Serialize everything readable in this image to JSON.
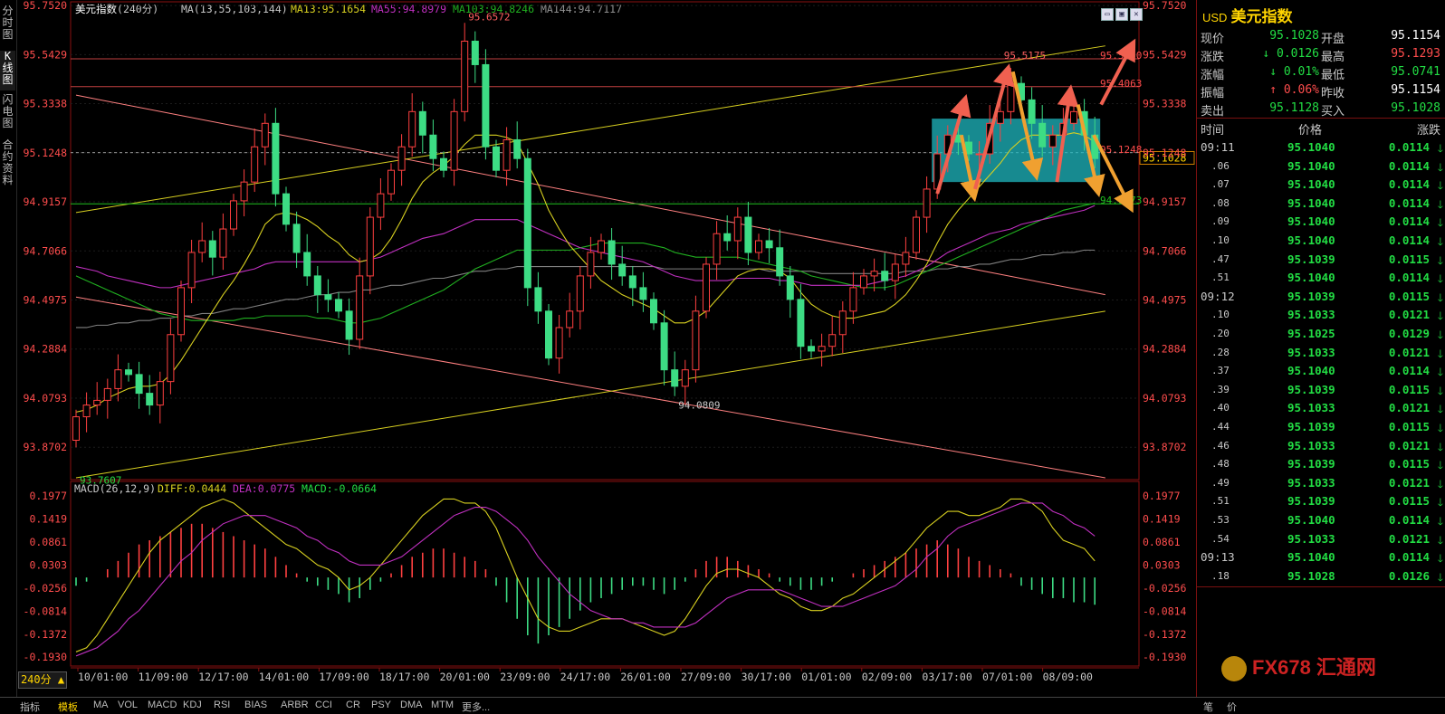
{
  "left_tabs": [
    "分时图",
    "K线图",
    "闪电图",
    "合约资料"
  ],
  "main_header": {
    "title": "美元指数",
    "period": "240分",
    "ma_label": "MA(13,55,103,144)",
    "ma13": "MA13:95.1654",
    "ma55": "MA55:94.8979",
    "ma103": "MA103:94.8246",
    "ma144": "MA144:94.7117"
  },
  "macd_header": {
    "label": "MACD(26,12,9)",
    "diff": "DIFF:0.0444",
    "dea": "DEA:0.0775",
    "macd": "MACD:-0.0664"
  },
  "period_selector": "240分 ▲",
  "bottom_tabs": [
    "指标",
    "模板",
    "MA",
    "VOL",
    "MACD",
    "KDJ",
    "RSI",
    "BIAS",
    "ARBR",
    "CCI",
    "CR",
    "PSY",
    "DMA",
    "MTM",
    "更多..."
  ],
  "bottom_right_tabs": [
    "笔",
    "价"
  ],
  "watermark": "FX678 汇通网",
  "colors": {
    "up": "#ff4040",
    "down": "#3ddc84",
    "ma13": "#d8d020",
    "ma55": "#20b020",
    "ma103": "#c030c0",
    "ma144": "#808080",
    "frame": "#8a1010"
  },
  "chart_data": {
    "type": "candlestick",
    "title": "美元指数",
    "price_axis": {
      "ticks": [
        95.752,
        95.5429,
        95.3338,
        95.1248,
        94.9157,
        94.7066,
        94.4975,
        94.2884,
        94.0793,
        93.8702
      ],
      "tick_labels": [
        "95.7520",
        "95.5429",
        "95.3338",
        "95.1248",
        "94.9157",
        "94.7066",
        "94.4975",
        "94.2884",
        "94.0793",
        "93.8702"
      ],
      "range": [
        93.74,
        95.76
      ]
    },
    "x_axis_labels": [
      "10/01:00",
      "11/09:00",
      "12/17:00",
      "14/01:00",
      "17/09:00",
      "18/17:00",
      "20/01:00",
      "23/09:00",
      "24/17:00",
      "26/01:00",
      "27/09:00",
      "30/17:00",
      "01/01:00",
      "02/09:00",
      "03/17:00",
      "07/01:00",
      "08/09:00"
    ],
    "price_annotations": [
      {
        "label": "95.6572",
        "value": 95.6572
      },
      {
        "label": "93.7607",
        "value": 93.7607
      },
      {
        "label": "94.0809",
        "value": 94.0809
      },
      {
        "label": "95.5175",
        "value": 95.5175
      },
      {
        "label": "95.5250",
        "value": 95.525
      },
      {
        "label": "95.4063",
        "value": 95.4063
      },
      {
        "label": "95.1248",
        "value": 95.1248
      },
      {
        "label": "94.9073",
        "value": 94.9073
      }
    ],
    "current_price_tag": "95.1028",
    "closes": [
      94.0,
      94.05,
      94.07,
      94.12,
      94.2,
      94.18,
      94.1,
      94.05,
      94.15,
      94.35,
      94.55,
      94.7,
      94.75,
      94.68,
      94.8,
      94.92,
      95.0,
      95.15,
      95.25,
      94.95,
      94.82,
      94.7,
      94.6,
      94.52,
      94.5,
      94.45,
      94.33,
      94.6,
      94.85,
      94.95,
      95.05,
      95.15,
      95.3,
      95.2,
      95.1,
      95.05,
      95.3,
      95.6,
      95.5,
      95.15,
      95.05,
      95.18,
      95.1,
      94.55,
      94.45,
      94.25,
      94.38,
      94.45,
      94.6,
      94.7,
      94.75,
      94.65,
      94.6,
      94.55,
      94.5,
      94.4,
      94.2,
      94.13,
      94.2,
      94.45,
      94.65,
      94.78,
      94.75,
      94.85,
      94.7,
      94.75,
      94.72,
      94.6,
      94.5,
      94.3,
      94.28,
      94.3,
      94.35,
      94.45,
      94.55,
      94.6,
      94.62,
      94.58,
      94.65,
      94.7,
      94.85,
      94.97,
      95.12,
      95.2,
      95.17,
      95.12,
      95.12,
      95.25,
      95.3,
      95.42,
      95.35,
      95.25,
      95.15,
      95.2,
      95.25,
      95.3,
      95.2,
      95.1
    ],
    "ma13": [
      94.02,
      94.03,
      94.05,
      94.08,
      94.1,
      94.12,
      94.13,
      94.13,
      94.14,
      94.18,
      94.24,
      94.31,
      94.38,
      94.45,
      94.52,
      94.58,
      94.65,
      94.73,
      94.82,
      94.86,
      94.87,
      94.86,
      94.84,
      94.81,
      94.77,
      94.74,
      94.69,
      94.66,
      94.67,
      94.7,
      94.76,
      94.84,
      94.93,
      95.0,
      95.04,
      95.07,
      95.11,
      95.16,
      95.2,
      95.2,
      95.2,
      95.19,
      95.17,
      95.08,
      94.99,
      94.88,
      94.8,
      94.73,
      94.68,
      94.63,
      94.58,
      94.55,
      94.52,
      94.5,
      94.48,
      94.46,
      94.43,
      94.4,
      94.4,
      94.42,
      94.45,
      94.5,
      94.55,
      94.6,
      94.62,
      94.63,
      94.63,
      94.62,
      94.59,
      94.53,
      94.48,
      94.45,
      94.43,
      94.42,
      94.42,
      94.43,
      94.44,
      94.45,
      94.48,
      94.52,
      94.58,
      94.65,
      94.74,
      94.82,
      94.88,
      94.93,
      94.98,
      95.03,
      95.08,
      95.14,
      95.18,
      95.2,
      95.2,
      95.2,
      95.2,
      95.21,
      95.2,
      95.17
    ],
    "ma55": [
      94.64,
      94.63,
      94.62,
      94.6,
      94.59,
      94.58,
      94.57,
      94.56,
      94.55,
      94.55,
      94.56,
      94.57,
      94.58,
      94.59,
      94.6,
      94.61,
      94.62,
      94.63,
      94.65,
      94.66,
      94.66,
      94.66,
      94.66,
      94.66,
      94.66,
      94.66,
      94.66,
      94.66,
      94.67,
      94.68,
      94.7,
      94.72,
      94.74,
      94.76,
      94.77,
      94.78,
      94.8,
      94.82,
      94.84,
      94.84,
      94.84,
      94.84,
      94.84,
      94.82,
      94.8,
      94.78,
      94.76,
      94.74,
      94.72,
      94.71,
      94.7,
      94.69,
      94.68,
      94.67,
      94.66,
      94.64,
      94.62,
      94.6,
      94.59,
      94.58,
      94.58,
      94.58,
      94.58,
      94.59,
      94.59,
      94.59,
      94.59,
      94.58,
      94.58,
      94.57,
      94.56,
      94.56,
      94.56,
      94.56,
      94.56,
      94.56,
      94.57,
      94.58,
      94.59,
      94.6,
      94.62,
      94.64,
      94.67,
      94.7,
      94.72,
      94.74,
      94.76,
      94.78,
      94.79,
      94.8,
      94.82,
      94.83,
      94.84,
      94.85,
      94.86,
      94.87,
      94.88,
      94.9
    ],
    "ma103": [
      94.6,
      94.58,
      94.56,
      94.54,
      94.52,
      94.5,
      94.48,
      94.46,
      94.44,
      94.43,
      94.42,
      94.41,
      94.41,
      94.41,
      94.41,
      94.41,
      94.42,
      94.42,
      94.43,
      94.43,
      94.43,
      94.43,
      94.43,
      94.42,
      94.42,
      94.41,
      94.4,
      94.4,
      94.41,
      94.42,
      94.44,
      94.46,
      94.48,
      94.5,
      94.52,
      94.54,
      94.57,
      94.6,
      94.63,
      94.65,
      94.67,
      94.69,
      94.71,
      94.71,
      94.71,
      94.71,
      94.71,
      94.71,
      94.72,
      94.73,
      94.74,
      94.74,
      94.74,
      94.74,
      94.74,
      94.73,
      94.72,
      94.7,
      94.69,
      94.68,
      94.68,
      94.68,
      94.68,
      94.68,
      94.67,
      94.66,
      94.65,
      94.64,
      94.63,
      94.62,
      94.6,
      94.59,
      94.58,
      94.57,
      94.56,
      94.55,
      94.55,
      94.55,
      94.56,
      94.58,
      94.6,
      94.62,
      94.64,
      94.66,
      94.68,
      94.7,
      94.72,
      94.74,
      94.76,
      94.78,
      94.8,
      94.82,
      94.84,
      94.86,
      94.88,
      94.89,
      94.9,
      94.91
    ],
    "ma144": [
      94.38,
      94.38,
      94.39,
      94.39,
      94.4,
      94.4,
      94.41,
      94.41,
      94.42,
      94.42,
      94.43,
      94.43,
      94.44,
      94.44,
      94.45,
      94.46,
      94.46,
      94.47,
      94.48,
      94.49,
      94.5,
      94.5,
      94.51,
      94.52,
      94.52,
      94.53,
      94.53,
      94.54,
      94.54,
      94.55,
      94.56,
      94.56,
      94.57,
      94.58,
      94.59,
      94.59,
      94.6,
      94.61,
      94.62,
      94.62,
      94.63,
      94.63,
      94.64,
      94.64,
      94.64,
      94.64,
      94.64,
      94.64,
      94.64,
      94.64,
      94.64,
      94.64,
      94.64,
      94.64,
      94.64,
      94.64,
      94.63,
      94.63,
      94.63,
      94.63,
      94.63,
      94.63,
      94.63,
      94.63,
      94.63,
      94.63,
      94.62,
      94.62,
      94.62,
      94.62,
      94.62,
      94.61,
      94.61,
      94.61,
      94.61,
      94.61,
      94.61,
      94.61,
      94.61,
      94.62,
      94.62,
      94.62,
      94.63,
      94.63,
      94.64,
      94.64,
      94.65,
      94.65,
      94.66,
      94.67,
      94.67,
      94.68,
      94.69,
      94.69,
      94.7,
      94.7,
      94.71,
      94.71
    ],
    "trendlines": [
      {
        "color": "#ff8080",
        "from": [
          0,
          95.37
        ],
        "to": [
          98,
          94.52
        ]
      },
      {
        "color": "#ff8080",
        "from": [
          0,
          94.51
        ],
        "to": [
          98,
          93.74
        ]
      },
      {
        "color": "#d8d020",
        "from": [
          0,
          94.87
        ],
        "to": [
          98,
          95.58
        ]
      },
      {
        "color": "#d8d020",
        "from": [
          0,
          93.74
        ],
        "to": [
          98,
          94.45
        ]
      }
    ],
    "horizontal_lines": [
      {
        "value": 95.525,
        "color": "#c04040"
      },
      {
        "value": 95.4063,
        "color": "#c04040"
      },
      {
        "value": 94.9073,
        "color": "#20c020"
      }
    ],
    "macd": {
      "axis_ticks": [
        0.1977,
        0.1419,
        0.0861,
        0.0303,
        -0.0256,
        -0.0814,
        -0.1372,
        -0.193
      ],
      "axis_labels": [
        "0.1977",
        "0.1419",
        "0.0861",
        "0.0303",
        "-0.0256",
        "-0.0814",
        "-0.1372",
        "-0.1930"
      ],
      "range": [
        -0.21,
        0.215
      ],
      "hist": [
        -0.02,
        -0.01,
        0.0,
        0.02,
        0.04,
        0.06,
        0.08,
        0.09,
        0.1,
        0.11,
        0.12,
        0.13,
        0.13,
        0.12,
        0.11,
        0.1,
        0.09,
        0.08,
        0.07,
        0.05,
        0.03,
        0.01,
        -0.01,
        -0.02,
        -0.03,
        -0.04,
        -0.06,
        -0.05,
        -0.03,
        -0.01,
        0.01,
        0.03,
        0.05,
        0.06,
        0.07,
        0.07,
        0.06,
        0.05,
        0.04,
        0.02,
        -0.02,
        -0.06,
        -0.1,
        -0.14,
        -0.16,
        -0.14,
        -0.12,
        -0.1,
        -0.08,
        -0.06,
        -0.05,
        -0.04,
        -0.03,
        -0.02,
        -0.02,
        -0.03,
        -0.04,
        -0.03,
        -0.01,
        0.02,
        0.04,
        0.05,
        0.05,
        0.04,
        0.03,
        0.02,
        0.01,
        -0.01,
        -0.02,
        -0.03,
        -0.03,
        -0.02,
        -0.01,
        0.0,
        0.01,
        0.02,
        0.03,
        0.04,
        0.05,
        0.06,
        0.07,
        0.08,
        0.09,
        0.08,
        0.07,
        0.05,
        0.04,
        0.03,
        0.02,
        0.01,
        -0.02,
        -0.03,
        -0.04,
        -0.05,
        -0.05,
        -0.06,
        -0.06,
        -0.066
      ],
      "diff": [
        -0.18,
        -0.17,
        -0.14,
        -0.1,
        -0.06,
        -0.02,
        0.02,
        0.06,
        0.09,
        0.11,
        0.13,
        0.15,
        0.17,
        0.18,
        0.19,
        0.18,
        0.16,
        0.14,
        0.12,
        0.1,
        0.08,
        0.07,
        0.05,
        0.03,
        0.02,
        0.0,
        -0.03,
        -0.02,
        0.0,
        0.03,
        0.06,
        0.09,
        0.12,
        0.15,
        0.17,
        0.19,
        0.19,
        0.18,
        0.18,
        0.16,
        0.12,
        0.06,
        0.0,
        -0.05,
        -0.1,
        -0.12,
        -0.13,
        -0.13,
        -0.12,
        -0.11,
        -0.1,
        -0.1,
        -0.1,
        -0.11,
        -0.12,
        -0.13,
        -0.14,
        -0.13,
        -0.1,
        -0.06,
        -0.02,
        0.01,
        0.02,
        0.02,
        0.01,
        0.0,
        -0.02,
        -0.04,
        -0.05,
        -0.07,
        -0.08,
        -0.08,
        -0.07,
        -0.05,
        -0.04,
        -0.02,
        0.0,
        0.02,
        0.04,
        0.06,
        0.09,
        0.12,
        0.14,
        0.16,
        0.16,
        0.15,
        0.15,
        0.16,
        0.17,
        0.19,
        0.19,
        0.18,
        0.16,
        0.12,
        0.09,
        0.08,
        0.07,
        0.04
      ],
      "dea": [
        -0.19,
        -0.18,
        -0.17,
        -0.15,
        -0.13,
        -0.1,
        -0.08,
        -0.05,
        -0.02,
        0.01,
        0.04,
        0.06,
        0.09,
        0.11,
        0.13,
        0.14,
        0.15,
        0.15,
        0.15,
        0.14,
        0.13,
        0.12,
        0.1,
        0.09,
        0.07,
        0.06,
        0.04,
        0.03,
        0.03,
        0.03,
        0.04,
        0.05,
        0.07,
        0.09,
        0.11,
        0.13,
        0.15,
        0.16,
        0.17,
        0.17,
        0.16,
        0.14,
        0.12,
        0.09,
        0.05,
        0.02,
        -0.01,
        -0.04,
        -0.06,
        -0.08,
        -0.09,
        -0.1,
        -0.1,
        -0.11,
        -0.11,
        -0.12,
        -0.12,
        -0.12,
        -0.12,
        -0.11,
        -0.09,
        -0.07,
        -0.05,
        -0.04,
        -0.03,
        -0.03,
        -0.03,
        -0.03,
        -0.04,
        -0.05,
        -0.06,
        -0.07,
        -0.07,
        -0.07,
        -0.06,
        -0.05,
        -0.04,
        -0.03,
        -0.02,
        0.0,
        0.02,
        0.05,
        0.07,
        0.1,
        0.12,
        0.13,
        0.14,
        0.15,
        0.16,
        0.17,
        0.18,
        0.18,
        0.18,
        0.16,
        0.15,
        0.13,
        0.12,
        0.1
      ]
    }
  },
  "quote_panel": {
    "currency": "USD",
    "name": "美元指数",
    "rows": [
      {
        "l1": "现价",
        "v1": "95.1028",
        "c1": "green",
        "l2": "开盘",
        "v2": "95.1154",
        "c2": "white"
      },
      {
        "l1": "涨跌",
        "v1": "↓ 0.0126",
        "c1": "green",
        "l2": "最高",
        "v2": "95.1293",
        "c2": "red"
      },
      {
        "l1": "涨幅",
        "v1": "↓ 0.01%",
        "c1": "green",
        "l2": "最低",
        "v2": "95.0741",
        "c2": "green"
      },
      {
        "l1": "振幅",
        "v1": "↑ 0.06%",
        "c1": "red",
        "l2": "昨收",
        "v2": "95.1154",
        "c2": "white"
      },
      {
        "l1": "卖出",
        "v1": "95.1128",
        "c1": "green",
        "l2": "买入",
        "v2": "95.1028",
        "c2": "green"
      }
    ],
    "tick_header": {
      "time": "时间",
      "price": "价格",
      "change": "涨跌"
    },
    "ticks": [
      {
        "time": "09:11",
        "minor": false,
        "price": "95.1040",
        "chg": "0.0114"
      },
      {
        "time": ".06",
        "minor": true,
        "price": "95.1040",
        "chg": "0.0114"
      },
      {
        "time": ".07",
        "minor": true,
        "price": "95.1040",
        "chg": "0.0114"
      },
      {
        "time": ".08",
        "minor": true,
        "price": "95.1040",
        "chg": "0.0114"
      },
      {
        "time": ".09",
        "minor": true,
        "price": "95.1040",
        "chg": "0.0114"
      },
      {
        "time": ".10",
        "minor": true,
        "price": "95.1040",
        "chg": "0.0114"
      },
      {
        "time": ".47",
        "minor": true,
        "price": "95.1039",
        "chg": "0.0115"
      },
      {
        "time": ".51",
        "minor": true,
        "price": "95.1040",
        "chg": "0.0114"
      },
      {
        "time": "09:12",
        "minor": false,
        "price": "95.1039",
        "chg": "0.0115"
      },
      {
        "time": ".10",
        "minor": true,
        "price": "95.1033",
        "chg": "0.0121"
      },
      {
        "time": ".20",
        "minor": true,
        "price": "95.1025",
        "chg": "0.0129"
      },
      {
        "time": ".28",
        "minor": true,
        "price": "95.1033",
        "chg": "0.0121"
      },
      {
        "time": ".37",
        "minor": true,
        "price": "95.1040",
        "chg": "0.0114"
      },
      {
        "time": ".39",
        "minor": true,
        "price": "95.1039",
        "chg": "0.0115"
      },
      {
        "time": ".40",
        "minor": true,
        "price": "95.1033",
        "chg": "0.0121"
      },
      {
        "time": ".44",
        "minor": true,
        "price": "95.1039",
        "chg": "0.0115"
      },
      {
        "time": ".46",
        "minor": true,
        "price": "95.1033",
        "chg": "0.0121"
      },
      {
        "time": ".48",
        "minor": true,
        "price": "95.1039",
        "chg": "0.0115"
      },
      {
        "time": ".49",
        "minor": true,
        "price": "95.1033",
        "chg": "0.0121"
      },
      {
        "time": ".51",
        "minor": true,
        "price": "95.1039",
        "chg": "0.0115"
      },
      {
        "time": ".53",
        "minor": true,
        "price": "95.1040",
        "chg": "0.0114"
      },
      {
        "time": ".54",
        "minor": true,
        "price": "95.1033",
        "chg": "0.0121"
      },
      {
        "time": "09:13",
        "minor": false,
        "price": "95.1040",
        "chg": "0.0114"
      },
      {
        "time": ".18",
        "minor": true,
        "price": "95.1028",
        "chg": "0.0126"
      }
    ]
  }
}
